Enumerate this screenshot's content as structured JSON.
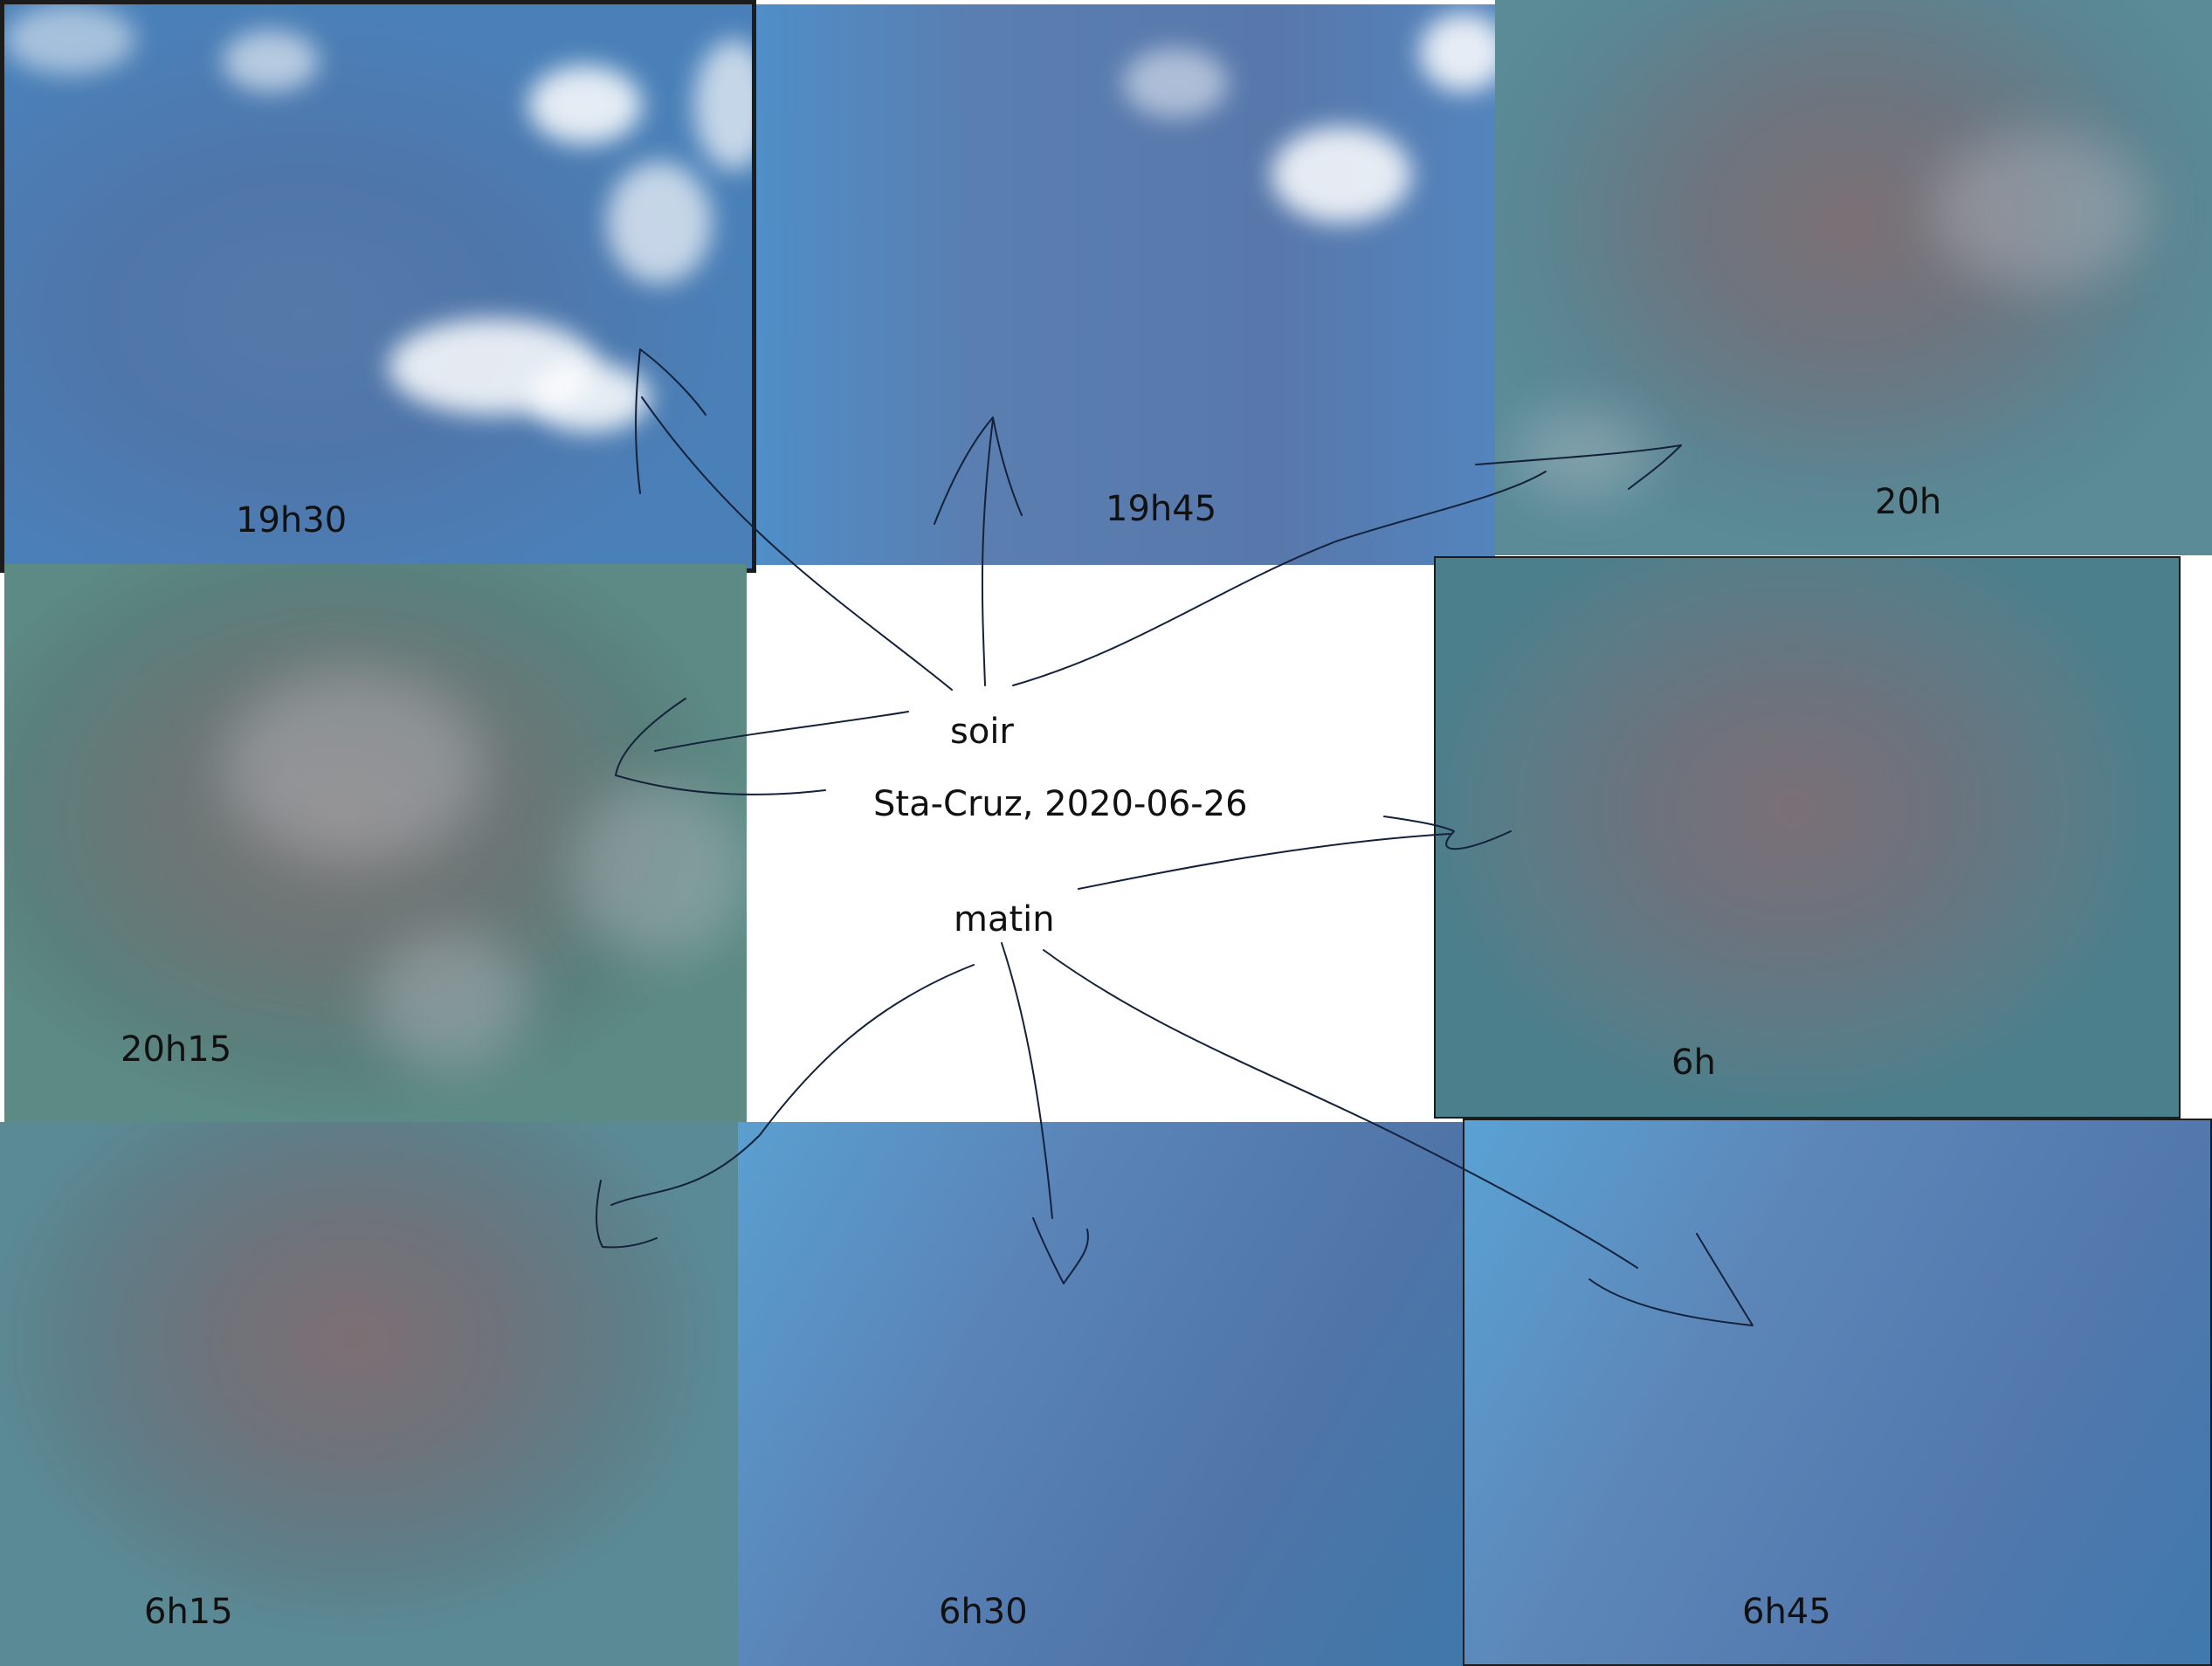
{
  "center": {
    "soir": "soir",
    "place_date": "Sta-Cruz, 2020-06-26",
    "matin": "matin"
  },
  "photos": [
    {
      "time": "19h30"
    },
    {
      "time": "19h45"
    },
    {
      "time": "20h"
    },
    {
      "time": "20h15"
    },
    {
      "time": "6h"
    },
    {
      "time": "6h15"
    },
    {
      "time": "6h30"
    },
    {
      "time": "6h45"
    }
  ]
}
